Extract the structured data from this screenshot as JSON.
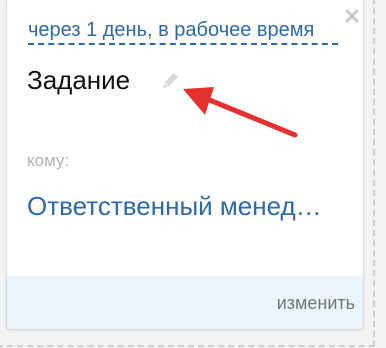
{
  "card": {
    "deadline_link": "через 1 день, в рабочее время",
    "task_title": "Задание",
    "to_label": "кому:",
    "assignee_link": "Ответственный менеджер",
    "change_button": "изменить"
  },
  "icons": {
    "close": "close-icon",
    "edit": "pencil-icon"
  },
  "colors": {
    "link": "#2d6aa8",
    "annotation_arrow": "#e53030",
    "footer_bg": "#e9f5fb"
  }
}
